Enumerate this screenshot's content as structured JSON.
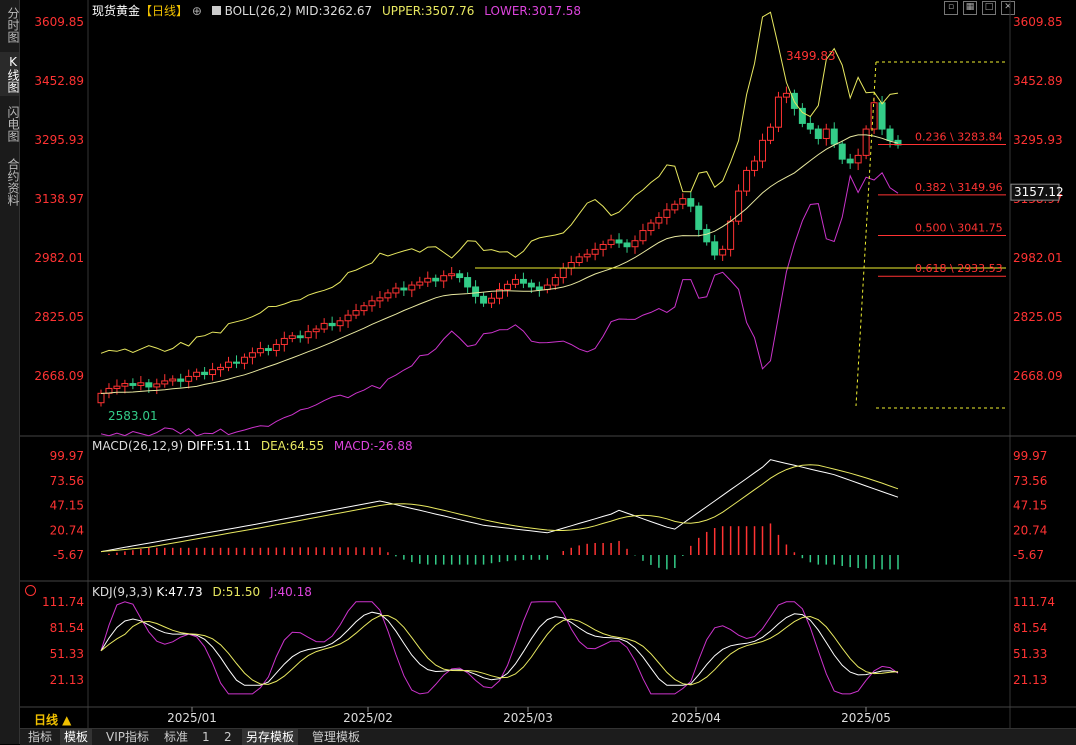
{
  "sidebar": {
    "tabs": [
      "分时图",
      "K线图",
      "闪电图",
      "合约资料"
    ],
    "active": 1
  },
  "header": {
    "instrument": "现货黄金",
    "period_tag": "【日线】",
    "boll": "BOLL(26,2)",
    "mid": "MID:3262.67",
    "upper": "UPPER:3507.76",
    "lower": "LOWER:3017.58"
  },
  "macd_header": {
    "name": "MACD(26,12,9)",
    "diff": "DIFF:51.11",
    "dea": "DEA:64.55",
    "macd": "MACD:-26.88"
  },
  "kdj_header": {
    "name": "KDJ(9,3,3)",
    "k": "K:47.73",
    "d": "D:51.50",
    "j": "J:40.18"
  },
  "price_axis": [
    "3609.85",
    "3452.89",
    "3295.93",
    "3138.97",
    "2982.01",
    "2825.05",
    "2668.09"
  ],
  "current_price": "3157.12",
  "macd_axis": [
    "99.97",
    "73.56",
    "47.15",
    "20.74",
    "-5.67"
  ],
  "kdj_axis": [
    "111.74",
    "81.54",
    "51.33",
    "21.13"
  ],
  "date_axis": [
    "2025/01",
    "2025/02",
    "2025/03",
    "2025/04",
    "2025/05"
  ],
  "annotations": {
    "high": "3499.83",
    "low": "2583.01"
  },
  "fib": [
    {
      "label": "0.236 \\ 3283.84",
      "value": 3283.84
    },
    {
      "label": "0.382 \\ 3149.96",
      "value": 3149.96
    },
    {
      "label": "0.500 \\ 3041.75",
      "value": 3041.75
    },
    {
      "label": "0.618 \\ 2933.53",
      "value": 2933.53
    }
  ],
  "period_label": "日线 ▲",
  "bottom_tabs": [
    "指标",
    "模板",
    "VIP指标",
    "标准",
    "1",
    "2",
    "另存模板",
    "管理模板"
  ],
  "window_buttons": [
    "restore-icon",
    "tile-icon",
    "max-icon",
    "close-icon"
  ],
  "colors": {
    "up": "#ff3333",
    "down": "#33cc88",
    "mid": "#e8e8a0",
    "band": "#e8e860",
    "lower": "#cc33cc",
    "fib": "#ff3333",
    "axis": "#ff3333"
  },
  "chart_data": {
    "type": "candlestick",
    "closes": [
      2622,
      2635,
      2641,
      2648,
      2643,
      2650,
      2639,
      2647,
      2655,
      2660,
      2654,
      2667,
      2678,
      2672,
      2685,
      2691,
      2705,
      2702,
      2718,
      2730,
      2741,
      2736,
      2752,
      2768,
      2775,
      2770,
      2786,
      2793,
      2808,
      2802,
      2815,
      2830,
      2842,
      2855,
      2868,
      2876,
      2889,
      2902,
      2897,
      2910,
      2918,
      2928,
      2921,
      2935,
      2940,
      2930,
      2905,
      2880,
      2862,
      2875,
      2898,
      2912,
      2925,
      2915,
      2905,
      2898,
      2910,
      2930,
      2955,
      2970,
      2985,
      2992,
      3005,
      3018,
      3030,
      3022,
      3012,
      3028,
      3055,
      3075,
      3090,
      3110,
      3125,
      3140,
      3120,
      3058,
      3025,
      2990,
      3005,
      3080,
      3160,
      3215,
      3240,
      3295,
      3330,
      3410,
      3420,
      3380,
      3340,
      3325,
      3300,
      3325,
      3285,
      3245,
      3235,
      3255,
      3325,
      3395,
      3325,
      3295,
      3283
    ],
    "ylim": [
      2583.01,
      3609.85
    ]
  }
}
